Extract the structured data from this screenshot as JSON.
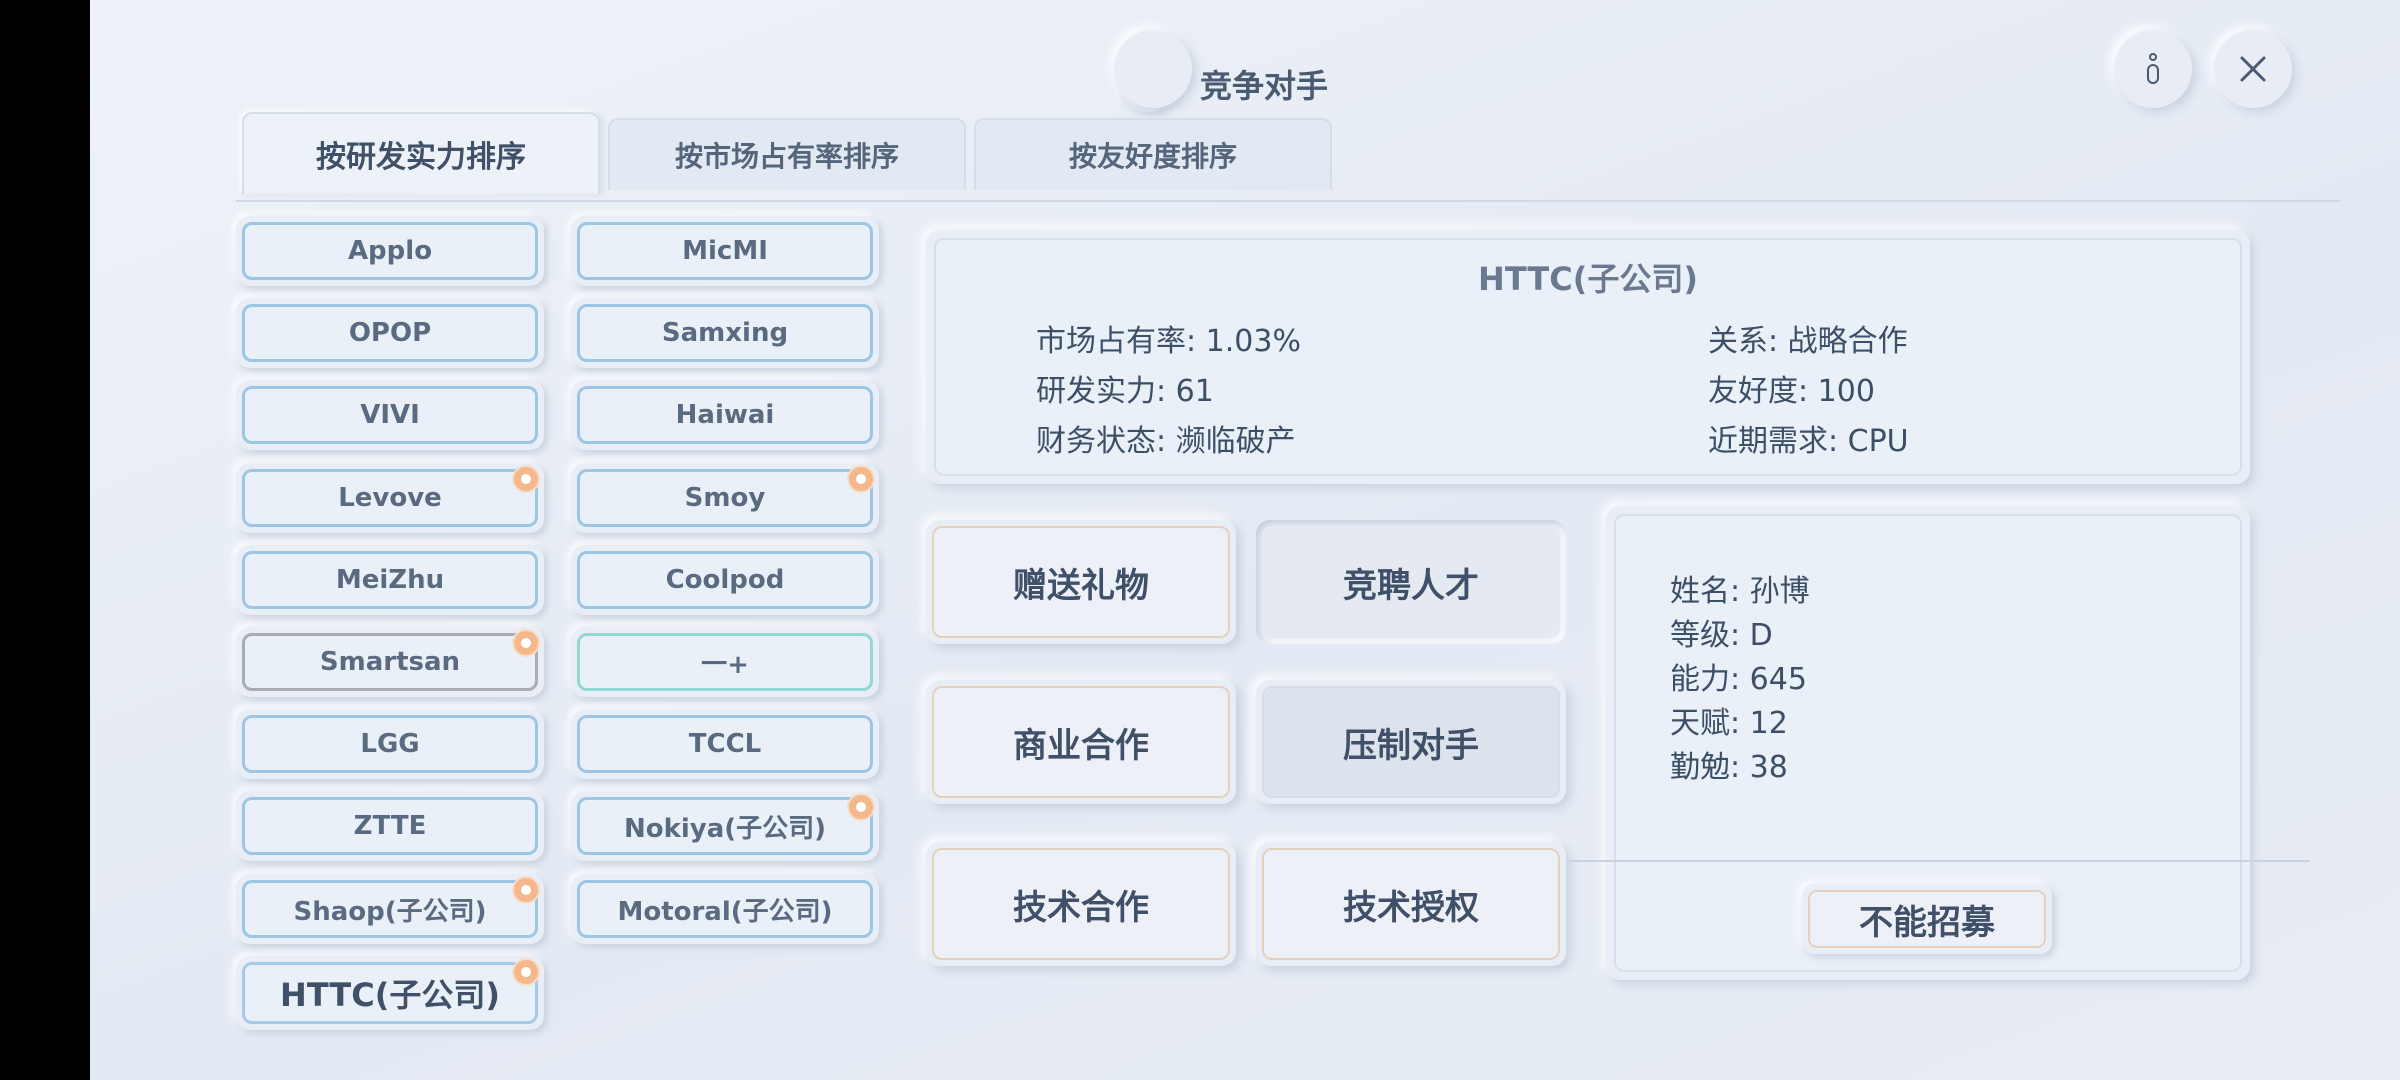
{
  "header": {
    "title": "竞争对手",
    "title_icon": "rook-icon",
    "info_icon": "info-icon",
    "close_icon": "close-icon"
  },
  "tabs": [
    {
      "label": "按研发实力排序",
      "active": true
    },
    {
      "label": "按市场占有率排序",
      "active": false
    },
    {
      "label": "按友好度排序",
      "active": false
    }
  ],
  "companies": [
    {
      "name": "Applo",
      "badge": false
    },
    {
      "name": "MicMI",
      "badge": false
    },
    {
      "name": "OPOP",
      "badge": false
    },
    {
      "name": "Samxing",
      "badge": false
    },
    {
      "name": "VIVI",
      "badge": false
    },
    {
      "name": "Haiwai",
      "badge": false
    },
    {
      "name": "Levove",
      "badge": true
    },
    {
      "name": "Smoy",
      "badge": true
    },
    {
      "name": "MeiZhu",
      "badge": false
    },
    {
      "name": "Coolpod",
      "badge": false
    },
    {
      "name": "Smartsan",
      "badge": true
    },
    {
      "name": "一+",
      "badge": false
    },
    {
      "name": "LGG",
      "badge": false
    },
    {
      "name": "TCCL",
      "badge": false
    },
    {
      "name": "ZTTE",
      "badge": false
    },
    {
      "name": "Nokiya(子公司)",
      "badge": true
    },
    {
      "name": "Shaop(子公司)",
      "badge": true
    },
    {
      "name": "Motoral(子公司)",
      "badge": false
    },
    {
      "name": "HTTC(子公司)",
      "badge": true
    }
  ],
  "selected": {
    "title": "HTTC(子公司)",
    "market_share": "市场占有率: 1.03%",
    "rd_power": "研发实力: 61",
    "finance": "财务状态: 濒临破产",
    "relation": "关系: 战略合作",
    "friendliness": "友好度: 100",
    "demand": "近期需求: CPU"
  },
  "actions": {
    "gift": "赠送礼物",
    "poach": "竞聘人才",
    "business": "商业合作",
    "suppress": "压制对手",
    "tech_coop": "技术合作",
    "tech_license": "技术授权"
  },
  "talent": {
    "name": "姓名: 孙博",
    "level": "等级: D",
    "ability": "能力: 645",
    "talent": "天赋: 12",
    "diligence": "勤勉: 38",
    "recruit_label": "不能招募"
  }
}
